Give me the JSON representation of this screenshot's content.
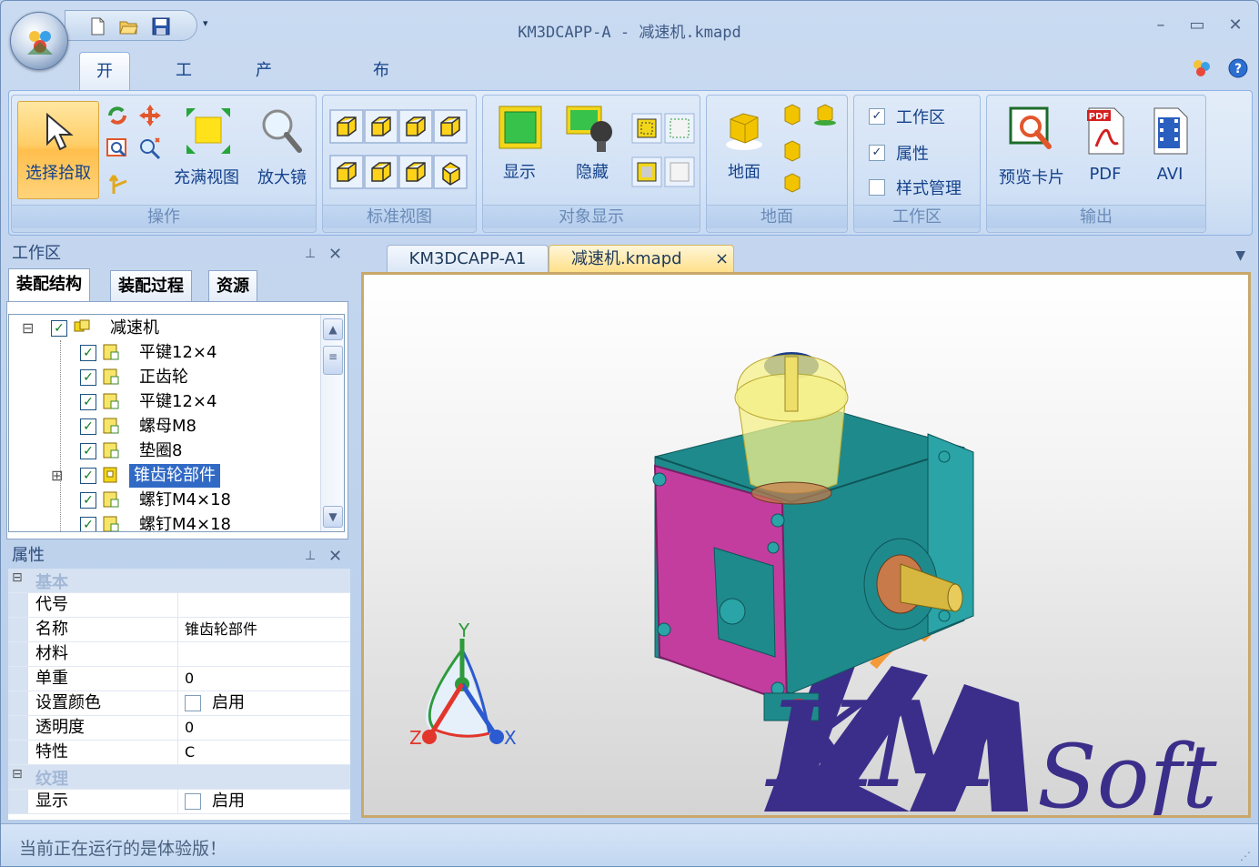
{
  "window": {
    "title": "KM3DCAPP-A - 减速机.kmapd",
    "controls": [
      "minimize-icon",
      "maximize-icon",
      "close-icon"
    ]
  },
  "qat": {
    "items": [
      "new-icon",
      "open-icon",
      "save-icon"
    ],
    "dropdown": "▾"
  },
  "tabs": [
    {
      "label": "开始",
      "active": true
    },
    {
      "label": "工具"
    },
    {
      "label": "产品管理"
    },
    {
      "label": "布线"
    }
  ],
  "ribbon": {
    "groups": {
      "operate": {
        "label": "操作",
        "select": "选择拾取",
        "fit": "充满视图",
        "magnifier": "放大镜"
      },
      "stdview": {
        "label": "标准视图"
      },
      "objdisp": {
        "label": "对象显示",
        "show": "显示",
        "hide": "隐藏"
      },
      "ground": {
        "label": "地面",
        "ground": "地面"
      },
      "workspace": {
        "label": "工作区",
        "items": [
          {
            "label": "工作区",
            "checked": true
          },
          {
            "label": "属性",
            "checked": true
          },
          {
            "label": "样式管理",
            "checked": false
          }
        ]
      },
      "output": {
        "label": "输出",
        "preview": "预览卡片",
        "pdf": "PDF",
        "avi": "AVI"
      }
    }
  },
  "workspace_panel": {
    "title": "工作区",
    "tabs": [
      "装配结构",
      "装配过程",
      "资源"
    ],
    "tree": [
      {
        "label": "减速机",
        "level": 0,
        "expand": "⊟"
      },
      {
        "label": "平键12×4",
        "level": 1
      },
      {
        "label": "正齿轮",
        "level": 1
      },
      {
        "label": "平键12×4",
        "level": 1
      },
      {
        "label": "螺母M8",
        "level": 1
      },
      {
        "label": "垫圈8",
        "level": 1
      },
      {
        "label": "锥齿轮部件",
        "level": 1,
        "expand": "⊞",
        "selected": true
      },
      {
        "label": "螺钉M4×18",
        "level": 1
      },
      {
        "label": "螺钉M4×18",
        "level": 1
      }
    ]
  },
  "props_panel": {
    "title": "属性",
    "cat1": "基本",
    "rows": [
      {
        "name": "代号",
        "value": ""
      },
      {
        "name": "名称",
        "value": "锥齿轮部件"
      },
      {
        "name": "材料",
        "value": ""
      },
      {
        "name": "单重",
        "value": "0"
      },
      {
        "name": "设置颜色",
        "value": "启用",
        "checkbox": true
      },
      {
        "name": "透明度",
        "value": "0"
      },
      {
        "name": "特性",
        "value": "C"
      }
    ],
    "cat2": "纹理",
    "rows2": [
      {
        "name": "显示",
        "value": "启用",
        "checkbox": true
      }
    ]
  },
  "doc_tabs": [
    {
      "label": "KM3DCAPP-A1",
      "active": false
    },
    {
      "label": "减速机.kmapd",
      "active": true,
      "close": "×"
    }
  ],
  "viewport": {
    "axes": {
      "x": "X",
      "y": "Y",
      "z": "Z"
    },
    "watermark": {
      "km": "KM",
      "soft": "Soft"
    }
  },
  "status": {
    "text": "当前正在运行的是体验版！"
  },
  "colors": {
    "accent": "#15428b",
    "selection": "#316ac5",
    "gearbox_body": "#1f8a8c",
    "gearbox_cover": "#c33d9f",
    "watermark": "#3b2e8a"
  }
}
